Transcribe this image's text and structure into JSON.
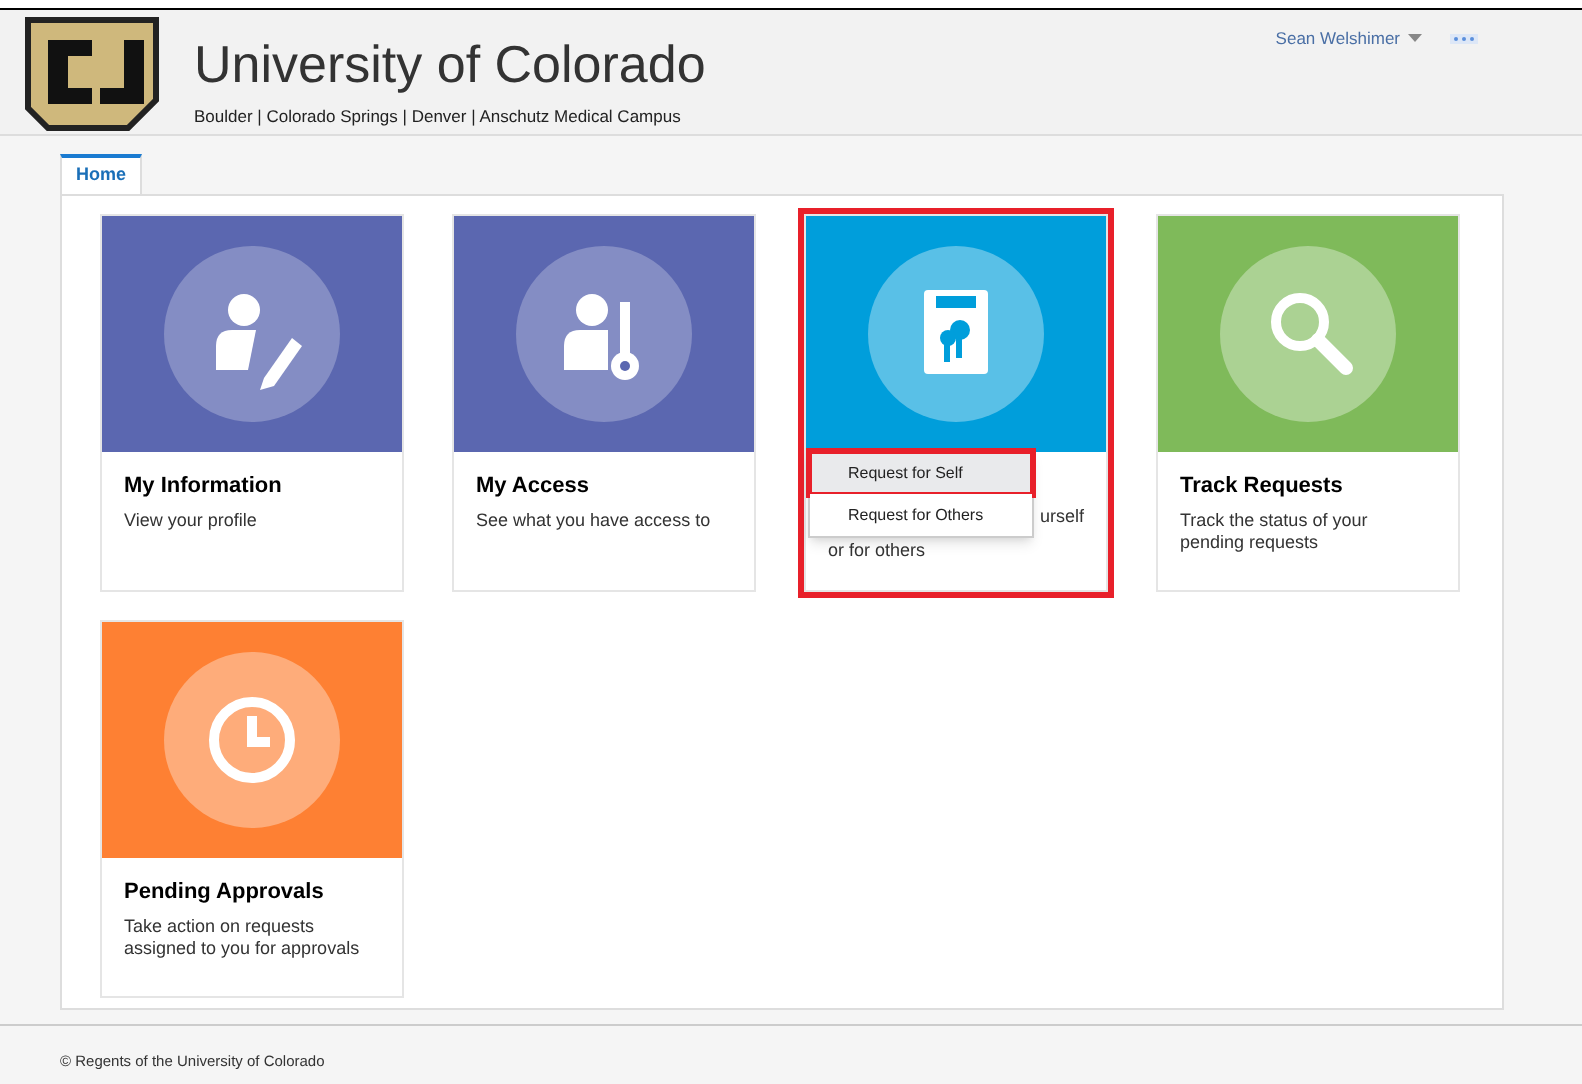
{
  "header": {
    "title": "University of Colorado",
    "campuses": "Boulder | Colorado Springs | Denver | Anschutz Medical Campus",
    "user": "Sean Welshimer"
  },
  "tabs": [
    {
      "label": "Home",
      "selected": true
    }
  ],
  "cards": [
    {
      "kind": "profile",
      "color": "#5b67b0",
      "title": "My Information",
      "description": "View your profile"
    },
    {
      "kind": "access",
      "color": "#5b67b0",
      "title": "My Access",
      "description": "See what you have access to"
    },
    {
      "kind": "request",
      "color": "#009edb",
      "highlighted": true,
      "visible_text": [
        "urself",
        "or for others"
      ],
      "menu": [
        {
          "label": "Request for Self",
          "selected": true
        },
        {
          "label": "Request for Others",
          "selected": false
        }
      ]
    },
    {
      "kind": "search",
      "color": "#7fba5a",
      "title": "Track Requests",
      "description": "Track the status of your pending requests"
    },
    {
      "kind": "clock",
      "color": "#fe8033",
      "title": "Pending Approvals",
      "description": "Take action on requests assigned to you for approvals"
    }
  ],
  "footer": "© Regents of the University of Colorado"
}
